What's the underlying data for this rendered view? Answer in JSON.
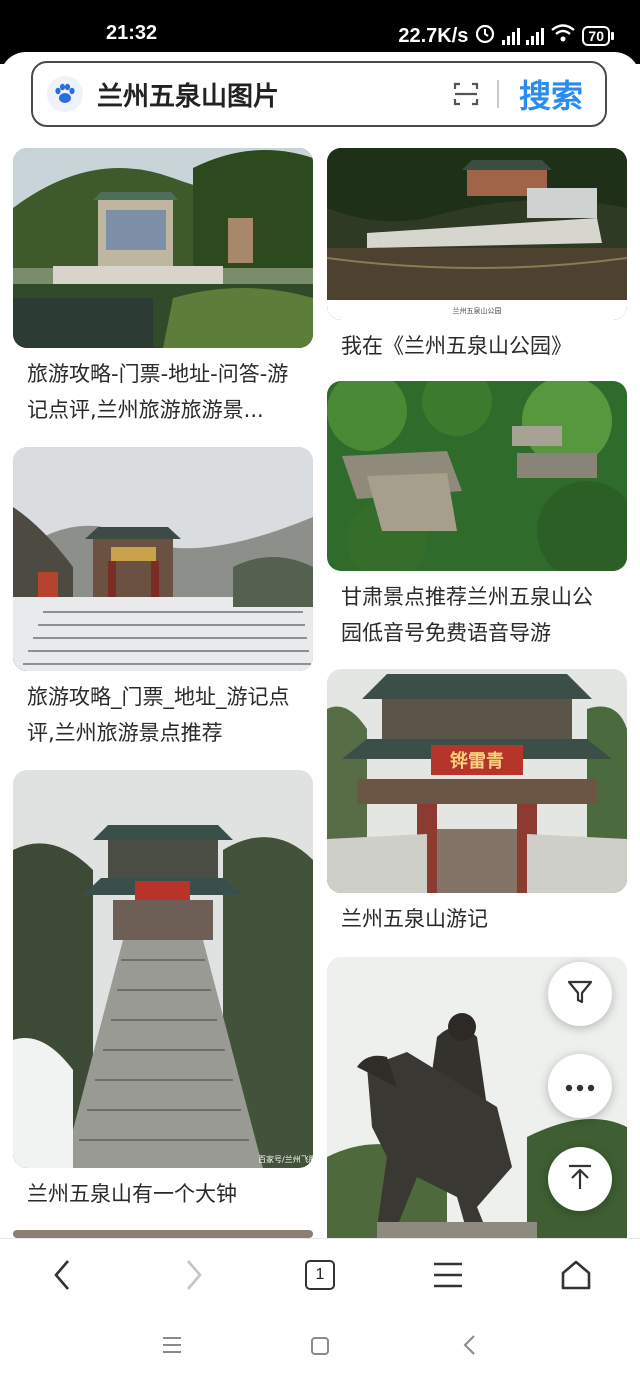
{
  "status_bar": {
    "time": "21:32",
    "network_speed": "22.7K/s",
    "battery": "70"
  },
  "search": {
    "query": "兰州五泉山图片",
    "button_label": "搜索"
  },
  "results_left": [
    {
      "caption": "旅游攻略-门票-地址-问答-游记点评,兰州旅游旅游景..."
    },
    {
      "caption": "旅游攻略_门票_地址_游记点评,兰州旅游景点推荐"
    },
    {
      "caption": "兰州五泉山有一个大钟"
    }
  ],
  "results_right": [
    {
      "caption": "我在《兰州五泉山公园》",
      "image_text": "兰州五泉山公园"
    },
    {
      "caption": "甘肃景点推荐兰州五泉山公园低音号免费语音导游"
    },
    {
      "caption": "兰州五泉山游记",
      "image_text": "铧雷青"
    },
    {
      "caption": ""
    }
  ],
  "image_watermarks": {
    "stairs_photo": "百家号/兰州飞騰",
    "gate_photo_sign": "铧雷青"
  },
  "bottom_nav": {
    "tab_count": "1"
  },
  "colors": {
    "accent": "#2a8cf0",
    "status_bar_bg": "#000000"
  },
  "icons": [
    "paw-icon",
    "scan-icon",
    "filter-icon",
    "more-icon",
    "back-to-top-icon",
    "back-icon",
    "forward-icon",
    "menu-icon",
    "home-icon"
  ]
}
